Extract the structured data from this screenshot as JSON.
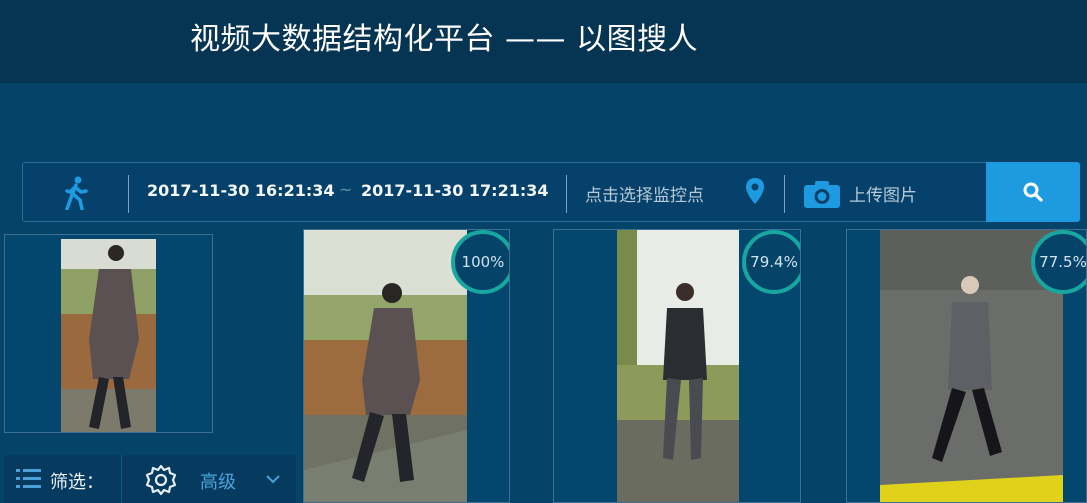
{
  "header": {
    "title": "视频大数据结构化平台 —— 以图搜人"
  },
  "search": {
    "start_time": "2017-11-30 16:21:34",
    "separator": "~",
    "end_time": "2017-11-30 17:21:34",
    "location_placeholder": "点击选择监控点",
    "upload_label": "上传图片"
  },
  "results": [
    {
      "score": "100%"
    },
    {
      "score": "79.4%"
    },
    {
      "score": "77.5%"
    }
  ],
  "filter": {
    "label": "筛选：",
    "advanced_label": "高级"
  },
  "colors": {
    "accent": "#1e9be0",
    "score_ring": "#17a6a0",
    "background": "#064369",
    "header": "#063453"
  }
}
